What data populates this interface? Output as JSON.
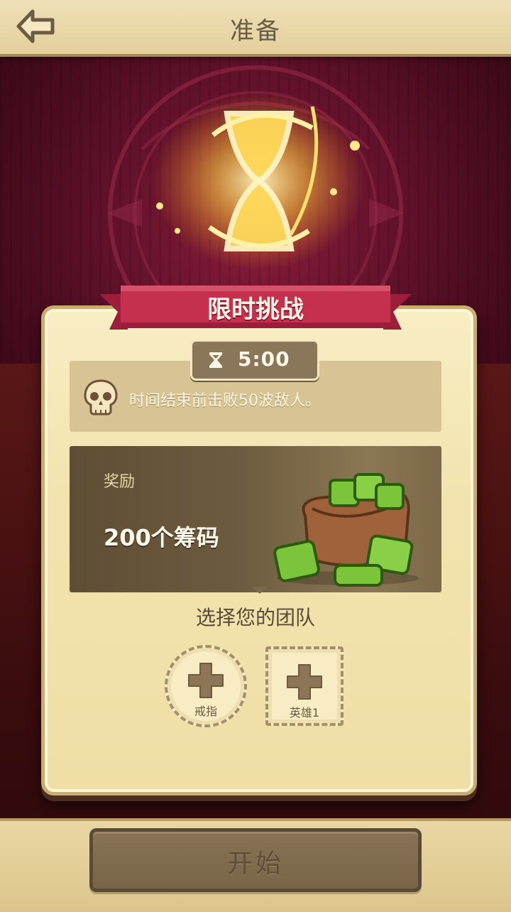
{
  "header": {
    "title": "准备",
    "back_icon": "back-arrow-icon"
  },
  "challenge": {
    "banner_title": "限时挑战",
    "timer": "5:00",
    "timer_icon": "hourglass-icon",
    "objective_icon": "skull-icon",
    "objective": "时间结束前击败50波敌人。"
  },
  "reward": {
    "label": "奖励",
    "value": "200个筹码",
    "icon": "gem-bag-icon"
  },
  "team": {
    "title": "选择您的团队",
    "slots": [
      {
        "label": "戒指",
        "icon": "plus-icon"
      },
      {
        "label": "英雄1",
        "icon": "plus-icon"
      }
    ]
  },
  "footer": {
    "start_label": "开始"
  },
  "colors": {
    "banner": "#c6304f",
    "card": "#f4e6b2",
    "button": "#7e6a4c",
    "backdrop": "#6e1530"
  }
}
